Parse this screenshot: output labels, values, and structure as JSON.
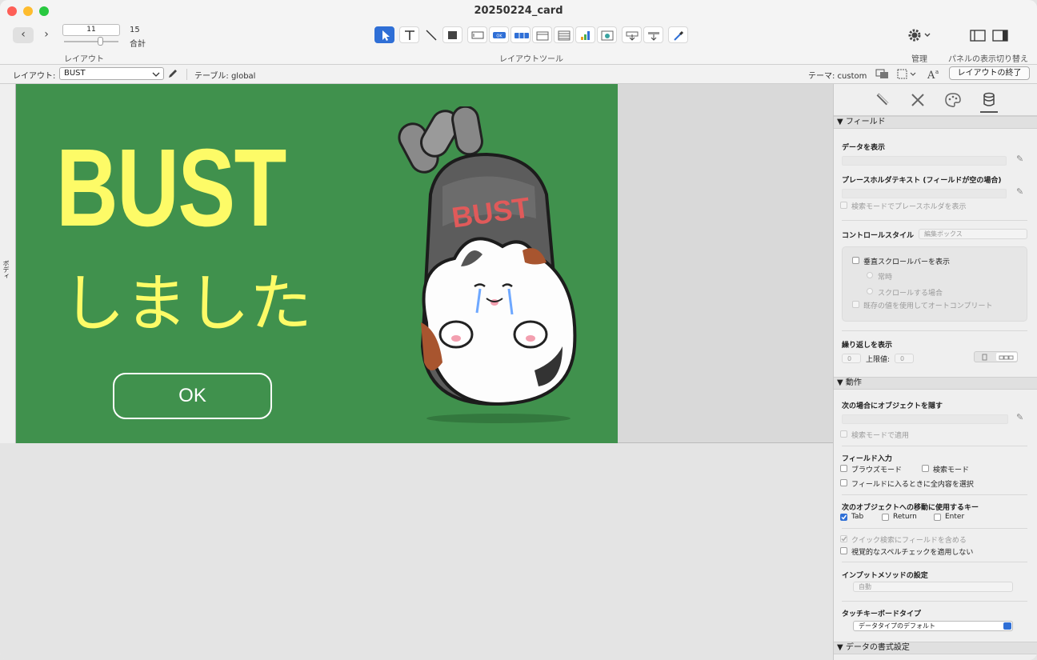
{
  "window": {
    "title": "20250224_card"
  },
  "toolbar": {
    "record_value": "11",
    "total_count": "15",
    "total_label": "合計",
    "layout_label": "レイアウト",
    "tools_label": "レイアウトツール",
    "manage_label": "管理",
    "panel_toggle_label": "パネルの表示切り替え"
  },
  "formatbar": {
    "layout_prefix": "レイアウト:",
    "layout_value": "BUST",
    "table_label": "テーブル: global",
    "theme_label": "テーマ: custom",
    "exit_button": "レイアウトの終了"
  },
  "canvas": {
    "part_label": "ボディ",
    "card": {
      "headline": "BUST",
      "subtext": "しました",
      "ok_button": "OK",
      "badge_text": "BUST",
      "bg_color": "#40914d",
      "text_color": "#fdfb67"
    }
  },
  "inspector": {
    "field_section": "▼ フィールド",
    "show_data": "データを表示",
    "placeholder": "プレースホルダテキスト (フィールドが空の場合)",
    "placeholder_find": "検索モードでプレースホルダを表示",
    "control_style": "コントロールスタイル",
    "control_style_value": "編集ボックス",
    "vscroll": "垂直スクロールバーを表示",
    "always": "常時",
    "when_scroll": "スクロールする場合",
    "autocomplete": "既存の値を使用してオートコンプリート",
    "repeat": "繰り返しを表示",
    "repeat_start": "0",
    "upper_label": "上限値:",
    "upper_value": "0",
    "behavior_section": "▼ 動作",
    "hide_when": "次の場合にオブジェクトを隠す",
    "apply_find": "検索モードで適用",
    "field_entry": "フィールド入力",
    "browse_mode": "ブラウズモード",
    "find_mode": "検索モード",
    "select_all": "フィールドに入るときに全内容を選択",
    "next_keys": "次のオブジェクトへの移動に使用するキー",
    "key_tab": "Tab",
    "key_return": "Return",
    "key_enter": "Enter",
    "quick_find": "クイック検索にフィールドを含める",
    "spellcheck": "視覚的なスペルチェックを適用しない",
    "input_method": "インプットメソッドの設定",
    "input_method_value": "自動",
    "touch_keyboard": "タッチキーボードタイプ",
    "touch_keyboard_value": "データタイプのデフォルト",
    "data_format_section": "▼ データの書式設定"
  }
}
